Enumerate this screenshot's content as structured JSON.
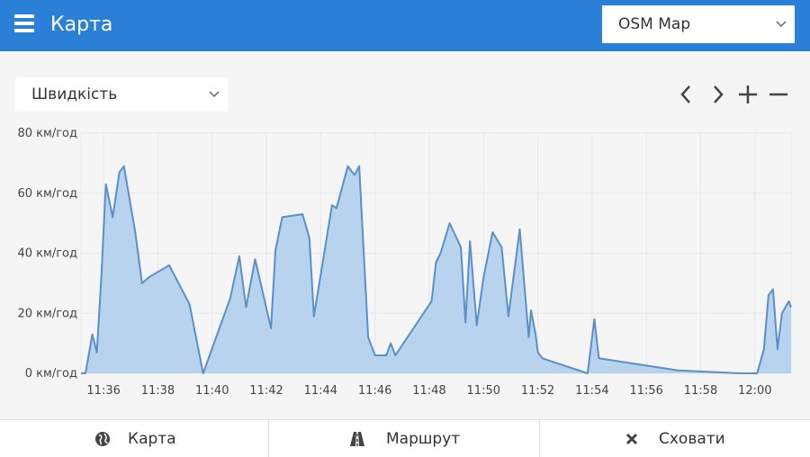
{
  "header": {
    "title": "Карта",
    "map_select_value": "OSM Map"
  },
  "controls": {
    "metric_select_value": "Швидкість",
    "nav_icons": [
      "chevron-left-icon",
      "chevron-right-icon",
      "plus-icon",
      "minus-icon"
    ]
  },
  "chart_data": {
    "type": "area",
    "title": "",
    "xlabel": "",
    "ylabel": "",
    "y_unit": "км/год",
    "ylim": [
      0,
      80
    ],
    "y_tick_labels": [
      "80 км/год",
      "60 км/год",
      "40 км/год",
      "20 км/год",
      "0 км/год"
    ],
    "y_tick_values": [
      80,
      60,
      40,
      20,
      0
    ],
    "x_tick_labels": [
      "11:36",
      "11:38",
      "11:40",
      "11:42",
      "11:44",
      "11:46",
      "11:48",
      "11:50",
      "11:52",
      "11:54",
      "11:56",
      "11:58",
      "12:00"
    ],
    "x_range": [
      "11:35:10",
      "12:01:20"
    ],
    "grid": true,
    "fill_color": "#b8d3ee",
    "line_color": "#5b8fc7",
    "series": [
      {
        "points": [
          [
            "11:35:10",
            0
          ],
          [
            "11:35:20",
            0
          ],
          [
            "11:35:35",
            13
          ],
          [
            "11:35:45",
            7
          ],
          [
            "11:35:55",
            32
          ],
          [
            "11:36:05",
            63
          ],
          [
            "11:36:20",
            52
          ],
          [
            "11:36:35",
            67
          ],
          [
            "11:36:45",
            69
          ],
          [
            "11:37:10",
            47
          ],
          [
            "11:37:25",
            30
          ],
          [
            "11:37:40",
            32
          ],
          [
            "11:38:25",
            36
          ],
          [
            "11:39:10",
            23
          ],
          [
            "11:39:40",
            0
          ],
          [
            "11:40:40",
            25
          ],
          [
            "11:41:00",
            39
          ],
          [
            "11:41:15",
            22
          ],
          [
            "11:41:35",
            38
          ],
          [
            "11:42:10",
            15
          ],
          [
            "11:42:20",
            41
          ],
          [
            "11:42:35",
            52
          ],
          [
            "11:43:20",
            53
          ],
          [
            "11:43:35",
            45
          ],
          [
            "11:43:45",
            19
          ],
          [
            "11:44:25",
            56
          ],
          [
            "11:44:35",
            55
          ],
          [
            "11:45:00",
            69
          ],
          [
            "11:45:15",
            66
          ],
          [
            "11:45:25",
            69
          ],
          [
            "11:45:45",
            12
          ],
          [
            "11:46:00",
            6
          ],
          [
            "11:46:25",
            6
          ],
          [
            "11:46:35",
            10
          ],
          [
            "11:46:45",
            6
          ],
          [
            "11:48:05",
            24
          ],
          [
            "11:48:15",
            37
          ],
          [
            "11:48:25",
            40
          ],
          [
            "11:48:45",
            50
          ],
          [
            "11:49:10",
            42
          ],
          [
            "11:49:20",
            17
          ],
          [
            "11:49:30",
            44
          ],
          [
            "11:49:45",
            16
          ],
          [
            "11:50:00",
            32
          ],
          [
            "11:50:20",
            47
          ],
          [
            "11:50:40",
            42
          ],
          [
            "11:50:55",
            19
          ],
          [
            "11:51:20",
            48
          ],
          [
            "11:51:40",
            12
          ],
          [
            "11:51:45",
            21
          ],
          [
            "11:51:55",
            13
          ],
          [
            "11:52:00",
            7
          ],
          [
            "11:52:10",
            5
          ],
          [
            "11:53:50",
            0
          ],
          [
            "11:54:05",
            18
          ],
          [
            "11:54:15",
            5
          ],
          [
            "11:57:10",
            1
          ],
          [
            "11:59:25",
            0
          ],
          [
            "12:00:05",
            0
          ],
          [
            "12:00:20",
            8
          ],
          [
            "12:00:30",
            26
          ],
          [
            "12:00:40",
            28
          ],
          [
            "12:00:50",
            8
          ],
          [
            "12:01:00",
            20
          ],
          [
            "12:01:15",
            24
          ],
          [
            "12:01:20",
            22
          ]
        ]
      }
    ]
  },
  "bottom_nav": {
    "items": [
      {
        "label": "Карта",
        "icon": "globe-icon"
      },
      {
        "label": "Маршрут",
        "icon": "road-icon"
      },
      {
        "label": "Сховати",
        "icon": "close-icon"
      }
    ]
  }
}
